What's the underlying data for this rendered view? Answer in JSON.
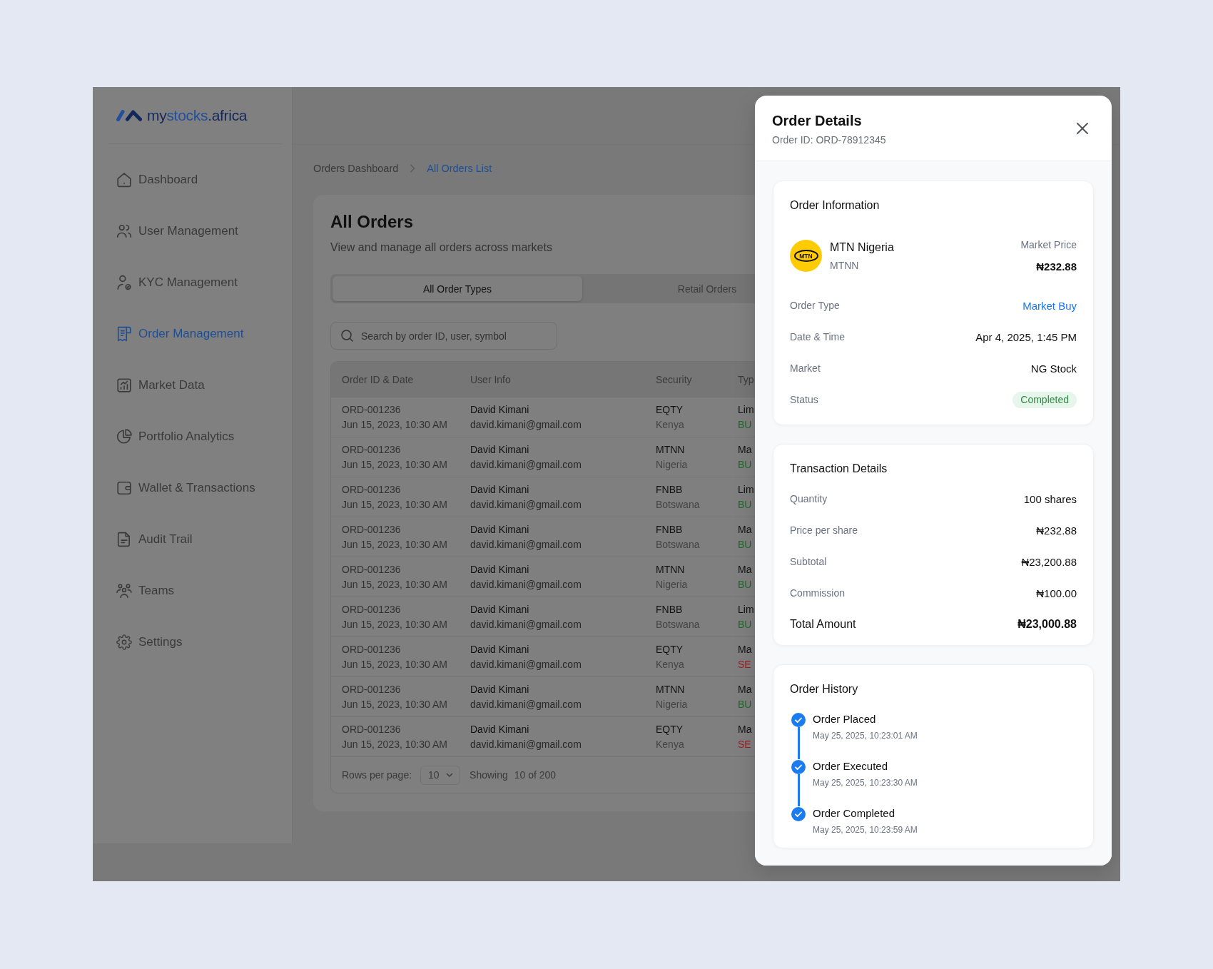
{
  "app": {
    "logo": {
      "prefix": "my",
      "highlight": "stocks",
      "suffix": ".africa"
    },
    "sidebar": {
      "items": [
        {
          "label": "Dashboard",
          "selected": false
        },
        {
          "label": "User Management",
          "selected": false
        },
        {
          "label": "KYC Management",
          "selected": false
        },
        {
          "label": "Order Management",
          "selected": true
        },
        {
          "label": "Market Data",
          "selected": false
        },
        {
          "label": "Portfolio Analytics",
          "selected": false
        },
        {
          "label": "Wallet & Transactions",
          "selected": false
        },
        {
          "label": "Audit Trail",
          "selected": false
        },
        {
          "label": "Teams",
          "selected": false
        },
        {
          "label": "Settings",
          "selected": false
        }
      ]
    },
    "breadcrumb": [
      {
        "label": "Orders Dashboard",
        "current": false
      },
      {
        "label": "All Orders List",
        "current": true
      }
    ],
    "page": {
      "title": "All Orders",
      "subtitle": "View and manage all orders across markets"
    },
    "tabs": [
      {
        "label": "All Order Types",
        "selected": true
      },
      {
        "label": "Retail Orders",
        "selected": false
      }
    ],
    "search": {
      "placeholder": "Search by order ID, user, symbol"
    },
    "table": {
      "columns": [
        "Order ID & Date",
        "User Info",
        "Security",
        "Typ"
      ],
      "rows": [
        {
          "order_id": "ORD-001236",
          "date": "Jun 15, 2023, 10:30 AM",
          "user_name": "David Kimani",
          "user_email": "david.kimani@gmail.com",
          "security": "EQTY",
          "country": "Kenya",
          "type": "Lim",
          "side": {
            "text": "BU",
            "kind": "buy"
          }
        },
        {
          "order_id": "ORD-001236",
          "date": "Jun 15, 2023, 10:30 AM",
          "user_name": "David Kimani",
          "user_email": "david.kimani@gmail.com",
          "security": "MTNN",
          "country": "Nigeria",
          "type": "Ma",
          "side": {
            "text": "BU",
            "kind": "buy"
          }
        },
        {
          "order_id": "ORD-001236",
          "date": "Jun 15, 2023, 10:30 AM",
          "user_name": "David Kimani",
          "user_email": "david.kimani@gmail.com",
          "security": "FNBB",
          "country": "Botswana",
          "type": "Lim",
          "side": {
            "text": "BU",
            "kind": "buy"
          }
        },
        {
          "order_id": "ORD-001236",
          "date": "Jun 15, 2023, 10:30 AM",
          "user_name": "David Kimani",
          "user_email": "david.kimani@gmail.com",
          "security": "FNBB",
          "country": "Botswana",
          "type": "Ma",
          "side": {
            "text": "BU",
            "kind": "buy"
          }
        },
        {
          "order_id": "ORD-001236",
          "date": "Jun 15, 2023, 10:30 AM",
          "user_name": "David Kimani",
          "user_email": "david.kimani@gmail.com",
          "security": "MTNN",
          "country": "Nigeria",
          "type": "Ma",
          "side": {
            "text": "BU",
            "kind": "buy"
          }
        },
        {
          "order_id": "ORD-001236",
          "date": "Jun 15, 2023, 10:30 AM",
          "user_name": "David Kimani",
          "user_email": "david.kimani@gmail.com",
          "security": "FNBB",
          "country": "Botswana",
          "type": "Lim",
          "side": {
            "text": "BU",
            "kind": "buy"
          }
        },
        {
          "order_id": "ORD-001236",
          "date": "Jun 15, 2023, 10:30 AM",
          "user_name": "David Kimani",
          "user_email": "david.kimani@gmail.com",
          "security": "EQTY",
          "country": "Kenya",
          "type": "Ma",
          "side": {
            "text": "SE",
            "kind": "sell"
          }
        },
        {
          "order_id": "ORD-001236",
          "date": "Jun 15, 2023, 10:30 AM",
          "user_name": "David Kimani",
          "user_email": "david.kimani@gmail.com",
          "security": "MTNN",
          "country": "Nigeria",
          "type": "Ma",
          "side": {
            "text": "BU",
            "kind": "buy"
          }
        },
        {
          "order_id": "ORD-001236",
          "date": "Jun 15, 2023, 10:30 AM",
          "user_name": "David Kimani",
          "user_email": "david.kimani@gmail.com",
          "security": "EQTY",
          "country": "Kenya",
          "type": "Ma",
          "side": {
            "text": "SE",
            "kind": "sell"
          }
        }
      ]
    },
    "pagination": {
      "rows_label": "Rows per page:",
      "rows_value": "10",
      "showing_label": "Showing",
      "showing_value": "10 of 200"
    }
  },
  "order_details": {
    "title": "Order Details",
    "order_id": "Order ID: ORD-78912345",
    "information": {
      "title": "Order Information",
      "logo_text": "MTN",
      "company": "MTN Nigeria",
      "symbol": "MTNN",
      "price_label": "Market Price",
      "price": "₦232.88",
      "rows": [
        {
          "label": "Order Type",
          "value": "Market Buy",
          "kind": "highlight"
        },
        {
          "label": "Date & Time",
          "value": "Apr 4, 2025, 1:45 PM",
          "kind": "text"
        },
        {
          "label": "Market",
          "value": "NG Stock",
          "kind": "text"
        },
        {
          "label": "Status",
          "value": "Completed",
          "kind": "badge"
        }
      ]
    },
    "transaction": {
      "title": "Transaction Details",
      "rows": [
        {
          "label": "Quantity",
          "value": "100 shares",
          "kind": "line"
        },
        {
          "label": "Price per share",
          "value": "₦232.88",
          "kind": "line"
        },
        {
          "label": "Subtotal",
          "value": "₦23,200.88",
          "kind": "line"
        },
        {
          "label": "Commission",
          "value": "₦100.00",
          "kind": "line"
        },
        {
          "label": "Total Amount",
          "value": "₦23,000.88",
          "kind": "total"
        }
      ]
    },
    "history": {
      "title": "Order History",
      "events": [
        {
          "label": "Order Placed",
          "time": "May 25, 2025, 10:23:01 AM",
          "done": true
        },
        {
          "label": "Order Executed",
          "time": "May 25, 2025, 10:23:30 AM",
          "done": true
        },
        {
          "label": "Order Completed",
          "time": "May 25, 2025, 10:23:59 AM",
          "done": true
        }
      ]
    }
  }
}
